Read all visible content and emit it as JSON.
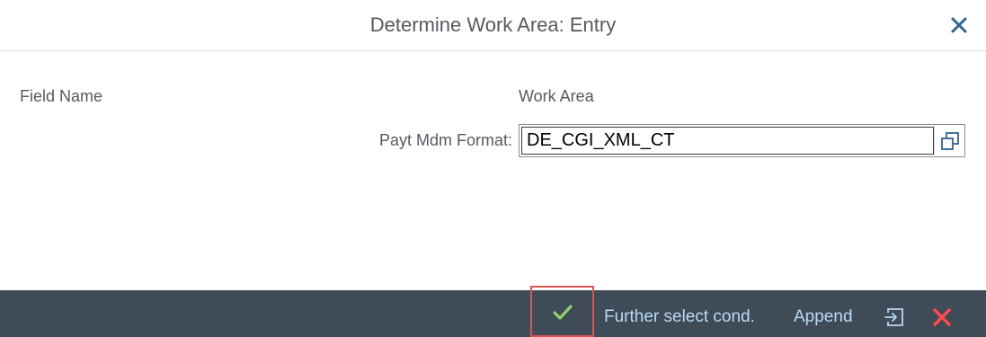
{
  "dialog": {
    "title": "Determine Work Area: Entry",
    "close_icon": "close-icon"
  },
  "content": {
    "field_name_header": "Field Name",
    "work_area_header": "Work Area",
    "fields": [
      {
        "label": "Payt Mdm Format:",
        "value": "DE_CGI_XML_CT",
        "help_icon": "value-help-icon"
      }
    ]
  },
  "toolbar": {
    "ok_icon": "checkmark-icon",
    "further_select_label": "Further select cond.",
    "append_label": "Append",
    "transfer_icon": "transfer-icon",
    "cancel_icon": "cancel-icon"
  },
  "colors": {
    "footer_bg": "#3f4b57",
    "link": "#b9d9f5",
    "highlight": "#d9534f",
    "ok": "#8cd36e",
    "cancel": "#ff4a4a"
  }
}
